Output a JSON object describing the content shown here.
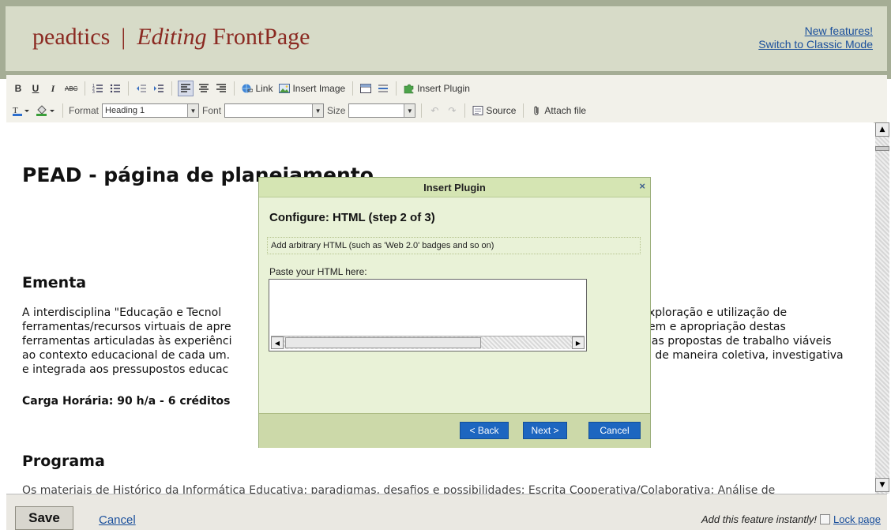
{
  "header": {
    "brand": "peadtics",
    "separator": "|",
    "editing_word": "Editing",
    "page_name": "FrontPage",
    "link_new_features": "New features!",
    "link_classic_mode": "Switch to Classic Mode"
  },
  "toolbar": {
    "bold": "B",
    "underline": "U",
    "italic": "I",
    "strike": "ABC",
    "link": "Link",
    "insert_image": "Insert Image",
    "insert_plugin": "Insert Plugin",
    "format_label": "Format",
    "format_value": "Heading 1",
    "font_label": "Font",
    "font_value": "",
    "size_label": "Size",
    "size_value": "",
    "source": "Source",
    "attach_file": "Attach file"
  },
  "editor": {
    "heading": "PEAD - página de planejamento",
    "ementa_heading": "Ementa",
    "para_lines": [
      "A interdisciplina \"Educação e Tecnol",
      "ferramentas/recursos virtuais de apre",
      "ferramentas articuladas às experiênci",
      "ao contexto educacional de cada um.",
      "e integrada aos pressupostos educac"
    ],
    "para_right_lines": [
      "xploração e utilização de",
      "em e apropriação destas",
      "las propostas de trabalho viáveis",
      "i de maneira coletiva, investigativa",
      ""
    ],
    "carga": "Carga Horária: 90 h/a  -  6 créditos",
    "programa_heading": "Programa",
    "last_line": "Os materiais de Histórico da Informática Educativa: paradigmas, desafios e possibilidades; Escrita Cooperativa/Colaborativa; Análise de"
  },
  "dialog": {
    "title": "Insert Plugin",
    "close": "×",
    "heading": "Configure: HTML (step 2 of 3)",
    "description": "Add arbitrary HTML (such as 'Web 2.0' badges and so on)",
    "paste_label": "Paste your HTML here:",
    "back": "< Back",
    "next": "Next >",
    "cancel": "Cancel"
  },
  "footer": {
    "save": "Save",
    "cancel": "Cancel",
    "promo": "Add this feature instantly!",
    "lock_page": "Lock page"
  },
  "colors": {
    "brand": "#8b2a22",
    "link": "#1a4f9c",
    "dialog_bg": "#e9f2d7",
    "dialog_button": "#1d66c0"
  }
}
